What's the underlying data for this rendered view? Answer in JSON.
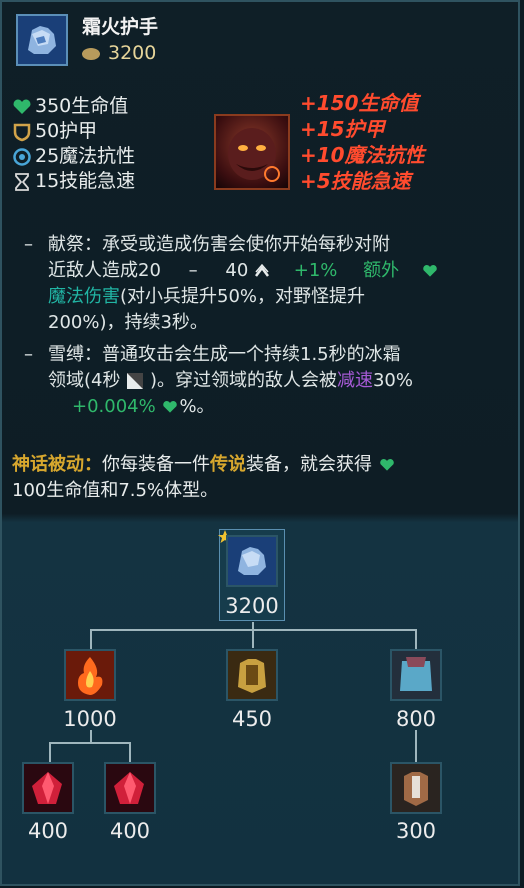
{
  "item": {
    "name": "霜火护手",
    "cost": "3200"
  },
  "stats": [
    {
      "icon": "heart-icon",
      "text": "350生命值"
    },
    {
      "icon": "shield-icon",
      "text": "50护甲"
    },
    {
      "icon": "magic-resist-icon",
      "text": "25魔法抗性"
    },
    {
      "icon": "hourglass-icon",
      "text": "15技能急速"
    }
  ],
  "bonuses": [
    "+150生命值",
    "+15护甲",
    "+10魔法抗性",
    "+5技能急速"
  ],
  "passives": {
    "immolate": {
      "line1": "献祭：承受或造成伤害会使你开始每秒对附",
      "line2_a": "近敌人造成20",
      "line2_b": "–",
      "line2_c": "40",
      "line2_d": "+1%",
      "line2_e": "额外",
      "line3_a": "魔法伤害",
      "line3_b": "(对小兵提升50%，对野怪提升",
      "line4": "200%)，持续3秒。"
    },
    "snowbind": {
      "line1": "雪缚：普通攻击会生成一个持续1.5秒的冰霜",
      "line2_a": "领域(4秒",
      "line2_b": ")。穿过领域的敌人会被",
      "line2_c": "减速",
      "line2_d": "30%",
      "line3_a": "+0.004%",
      "line3_b": "%。"
    }
  },
  "mythic": {
    "label": "神话被动：",
    "text_a": "你每装备一件",
    "legendary": "传说",
    "text_b": "装备，就会获得",
    "line2": "100生命值和7.5%体型。"
  },
  "tree": {
    "root": "3200",
    "children": [
      "1000",
      "450",
      "800"
    ],
    "grandchildren": [
      "400",
      "400",
      "300"
    ]
  },
  "colors": {
    "bonus_red": "#ff4b2e",
    "teal": "#21b5a4",
    "green": "#2fb86b",
    "gold": "#d7a72e",
    "purple": "#a65ad6"
  }
}
